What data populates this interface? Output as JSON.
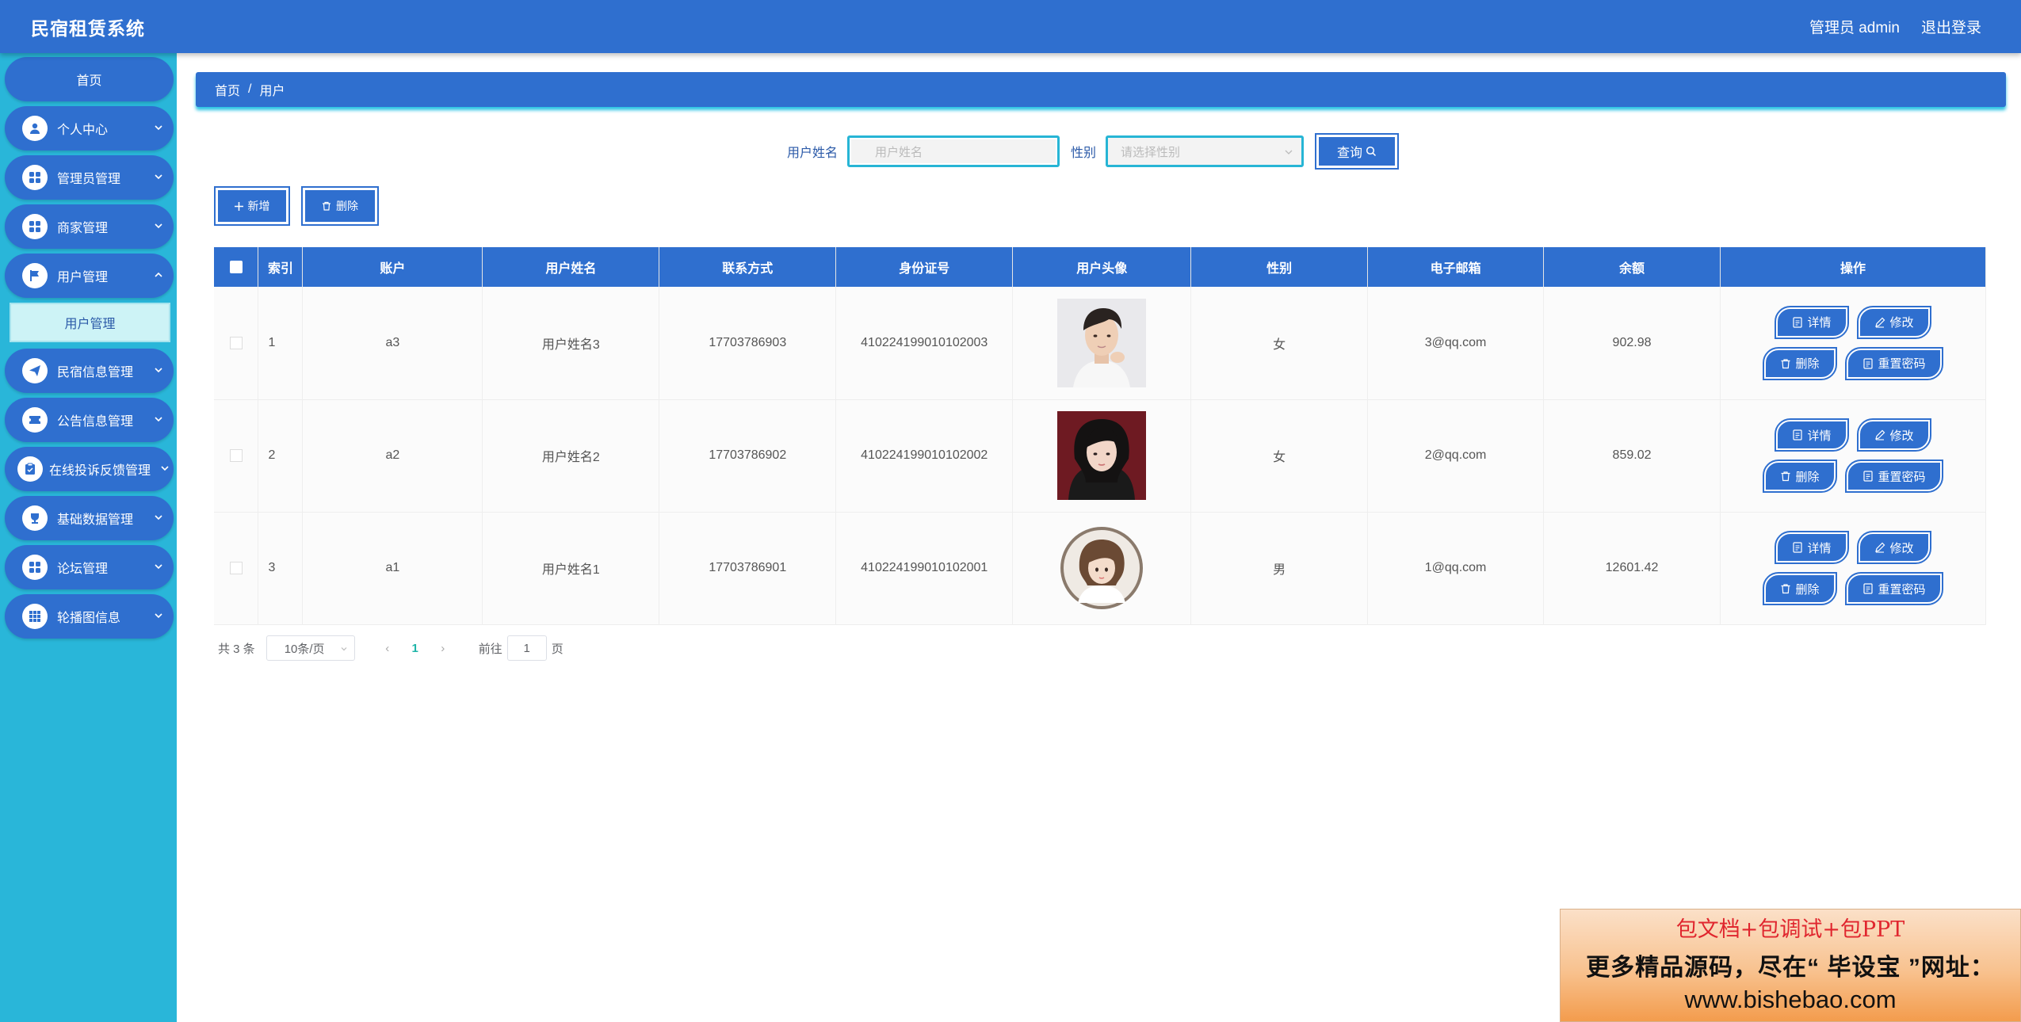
{
  "header": {
    "app_title": "民宿租赁系统",
    "user_label": "管理员 admin",
    "logout_label": "退出登录"
  },
  "sidebar": {
    "home_label": "首页",
    "items": [
      {
        "label": "个人中心",
        "icon": "user-icon"
      },
      {
        "label": "管理员管理",
        "icon": "grid-icon"
      },
      {
        "label": "商家管理",
        "icon": "grid-icon"
      },
      {
        "label": "用户管理",
        "icon": "flag-icon"
      },
      {
        "label": "民宿信息管理",
        "icon": "send-icon"
      },
      {
        "label": "公告信息管理",
        "icon": "ticket-icon"
      },
      {
        "label": "在线投诉反馈管理",
        "icon": "clipboard-icon"
      },
      {
        "label": "基础数据管理",
        "icon": "trophy-icon"
      },
      {
        "label": "论坛管理",
        "icon": "grid-icon"
      },
      {
        "label": "轮播图信息",
        "icon": "apps-icon"
      }
    ],
    "submenu_label": "用户管理"
  },
  "breadcrumb": {
    "home": "首页",
    "separator": "/",
    "current": "用户"
  },
  "search": {
    "name_label": "用户姓名",
    "name_placeholder": "用户姓名",
    "gender_label": "性别",
    "gender_placeholder": "请选择性别",
    "query_label": "查询"
  },
  "actions": {
    "add_label": "新增",
    "delete_label": "删除"
  },
  "table": {
    "headers": [
      "索引",
      "账户",
      "用户姓名",
      "联系方式",
      "身份证号",
      "用户头像",
      "性别",
      "电子邮箱",
      "余额",
      "操作"
    ],
    "rows": [
      {
        "index": "1",
        "account": "a3",
        "name": "用户姓名3",
        "phone": "17703786903",
        "id_card": "410224199010102003",
        "gender": "女",
        "email": "3@qq.com",
        "balance": "902.98"
      },
      {
        "index": "2",
        "account": "a2",
        "name": "用户姓名2",
        "phone": "17703786902",
        "id_card": "410224199010102002",
        "gender": "女",
        "email": "2@qq.com",
        "balance": "859.02"
      },
      {
        "index": "3",
        "account": "a1",
        "name": "用户姓名1",
        "phone": "17703786901",
        "id_card": "410224199010102001",
        "gender": "男",
        "email": "1@qq.com",
        "balance": "12601.42"
      }
    ],
    "op_labels": {
      "detail": "详情",
      "edit": "修改",
      "delete": "删除",
      "reset": "重置密码"
    }
  },
  "pager": {
    "total": "共 3 条",
    "page_size": "10条/页",
    "current_page": "1",
    "goto_label": "前往",
    "goto_value": "1",
    "page_unit": "页"
  },
  "ad": {
    "line1": "包文档+包调试+包PPT",
    "line2": "更多精品源码，尽在“ 毕设宝 ”网址：",
    "line3": "www.bishebao.com"
  },
  "colors": {
    "primary": "#2f6fcf",
    "sidebar": "#29b6d9",
    "accent": "#27c4e4"
  }
}
